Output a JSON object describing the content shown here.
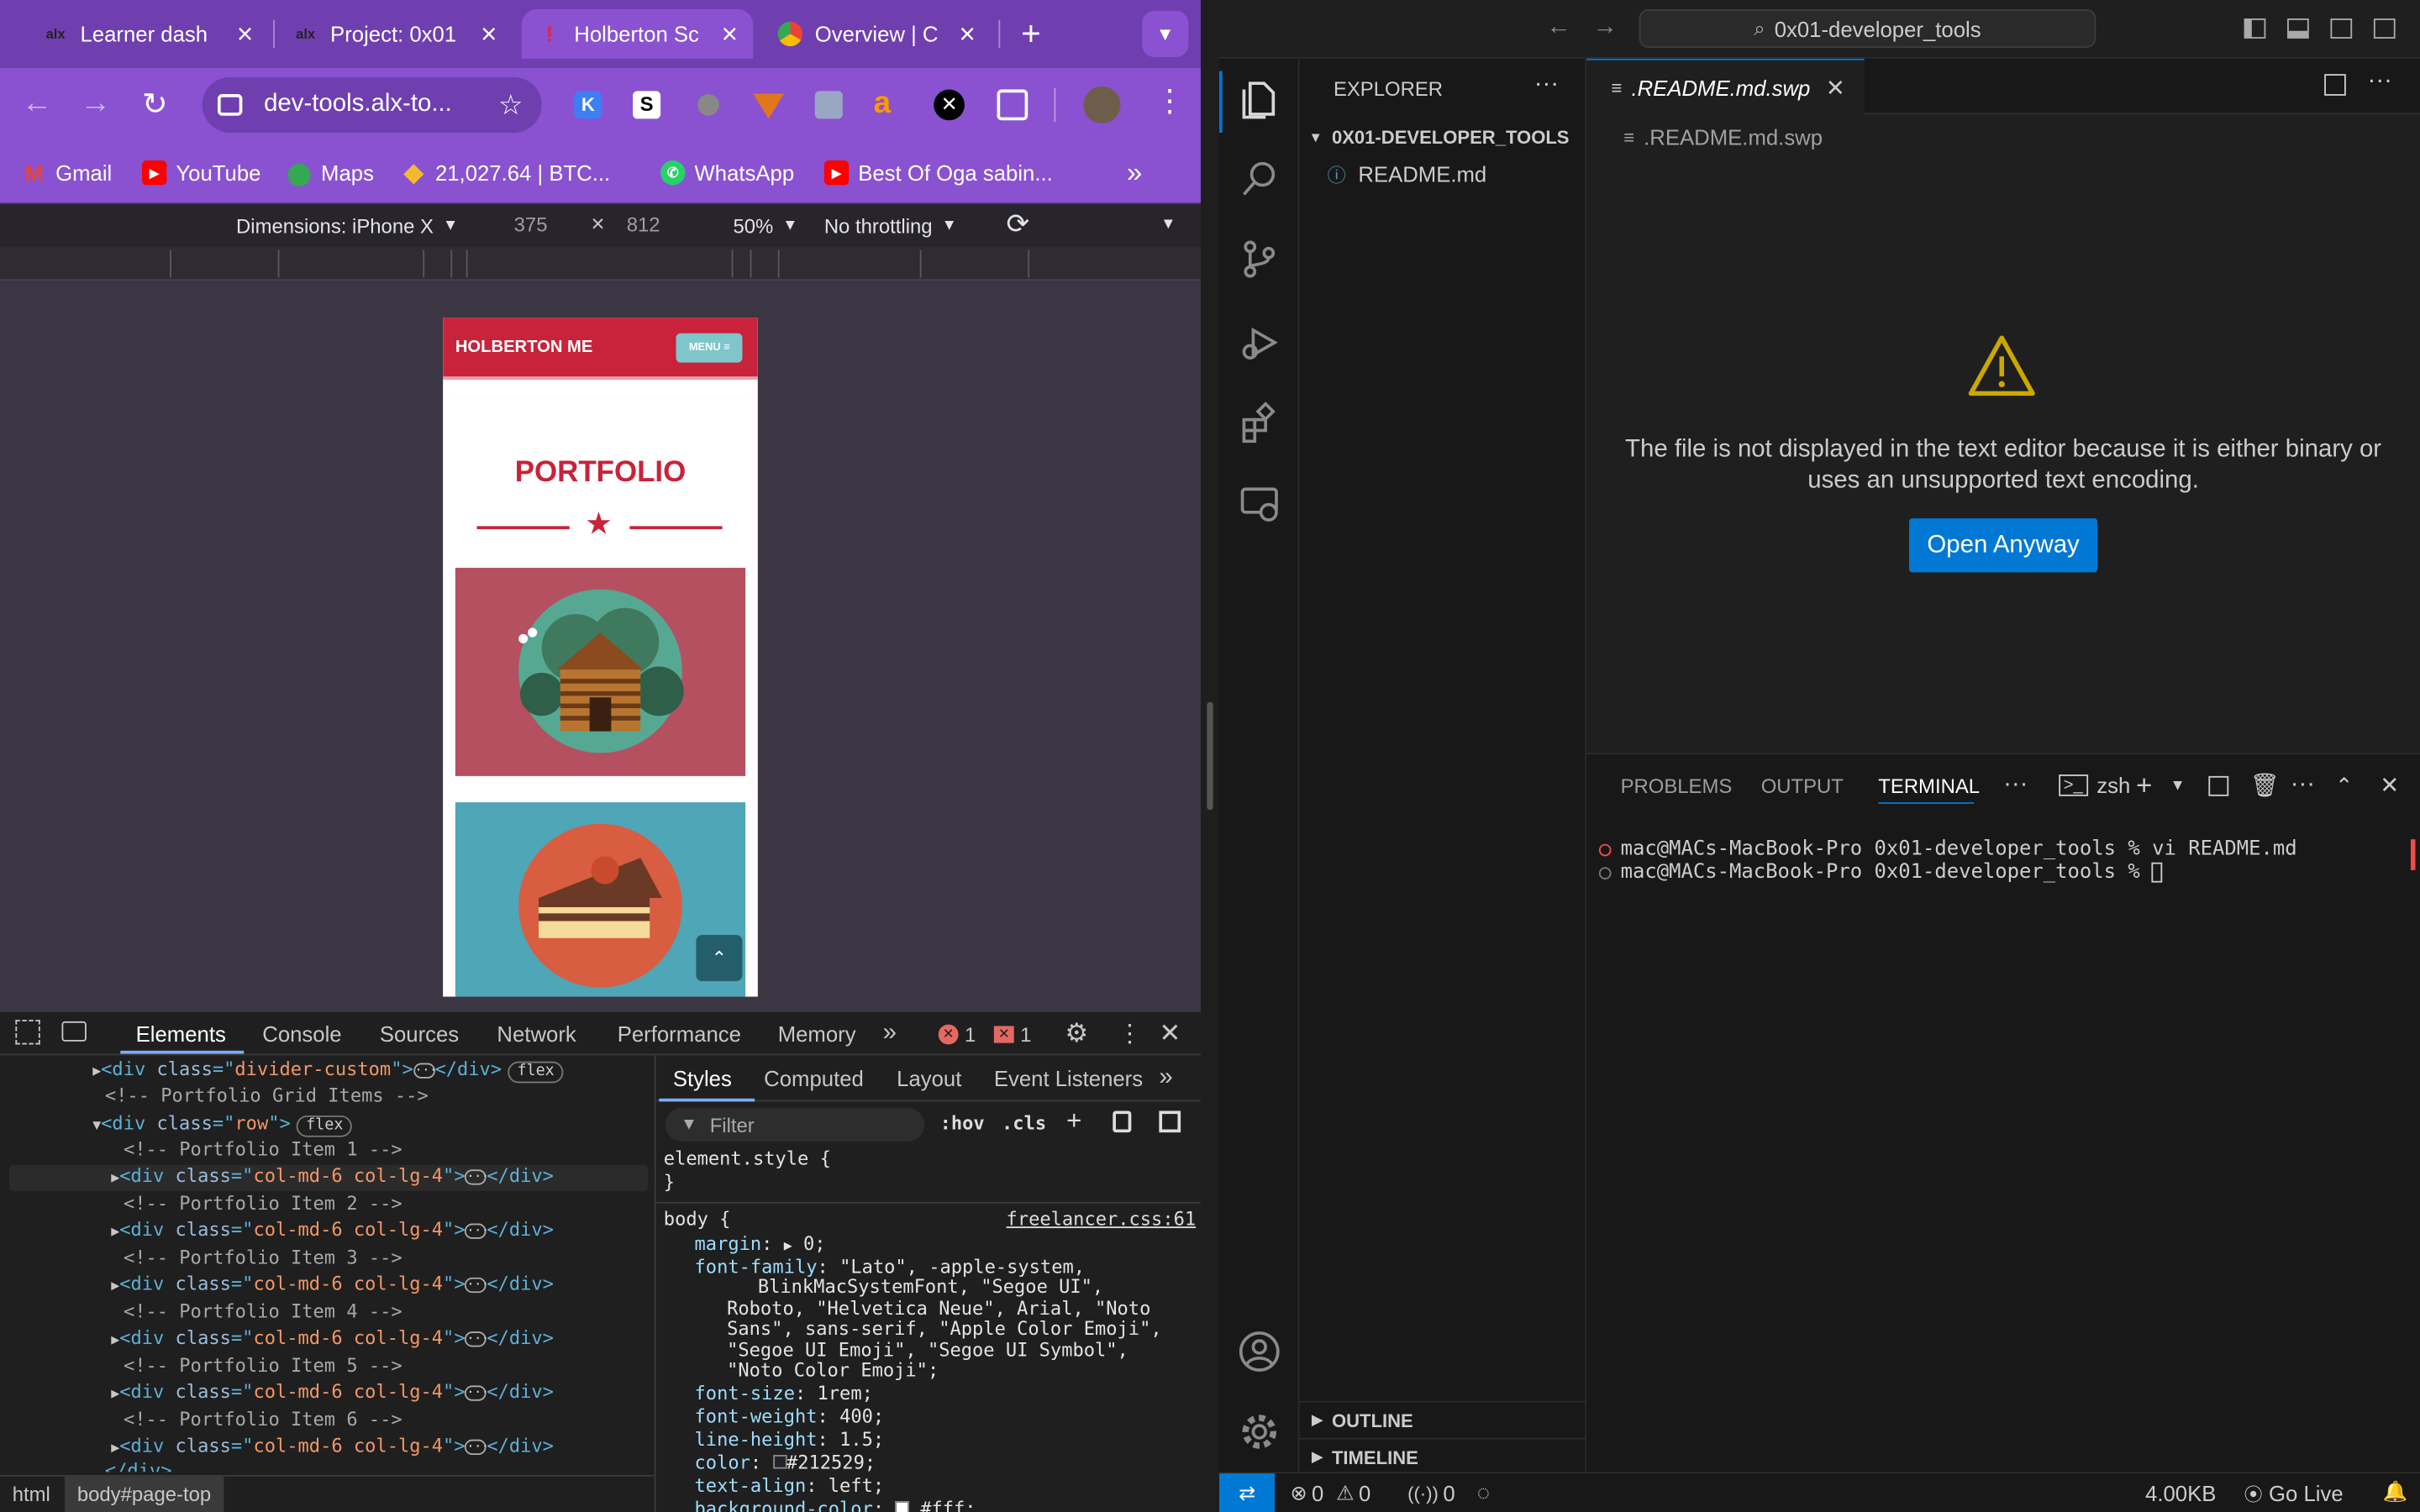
{
  "browser": {
    "tabs": [
      {
        "title": "Learner dash",
        "fav": "alx"
      },
      {
        "title": "Project: 0x01",
        "fav": "alx"
      },
      {
        "title": "Holberton Sc",
        "fav": "!"
      },
      {
        "title": "Overview | C",
        "fav": "G"
      }
    ],
    "address": "dev-tools.alx-to...",
    "bookmarks": [
      "Gmail",
      "YouTube",
      "Maps",
      "21,027.64 | BTC...",
      "WhatsApp",
      "Best Of Oga sabin..."
    ],
    "device": {
      "dimensions_label": "Dimensions: iPhone X",
      "width": "375",
      "times": "×",
      "height": "812",
      "zoom": "50%",
      "throttling": "No throttling"
    },
    "site": {
      "brand": "HOLBERTON ME",
      "menu_label": "MENU ≡",
      "heading": "PORTFOLIO"
    },
    "devtools": {
      "tabs": [
        "Elements",
        "Console",
        "Sources",
        "Network",
        "Performance",
        "Memory"
      ],
      "error_count": "1",
      "issue_count": "1",
      "subtabs": [
        "Styles",
        "Computed",
        "Layout",
        "Event Listeners"
      ],
      "filter_placeholder": "Filter",
      "hov": ":hov",
      "cls": ".cls",
      "breadcrumb": [
        "html",
        "body#page-top"
      ],
      "dom": {
        "divider_class": "divider-custom",
        "flex_pill": "flex",
        "grid_comment": "<!-- Portfolio Grid Items -->",
        "row_class": "row",
        "item_class": "col-md-6 col-lg-4",
        "item_comments": [
          "<!-- Portfolio Item 1 -->",
          "<!-- Portfolio Item 2 -->",
          "<!-- Portfolio Item 3 -->",
          "<!-- Portfolio Item 4 -->",
          "<!-- Portfolio Item 5 -->",
          "<!-- Portfolio Item 6 -->"
        ],
        "closing": "</div>"
      },
      "styles": {
        "element_style": "element.style {",
        "close_brace": "}",
        "body_selector": "body {",
        "source": "freelancer.css:61",
        "margin_prop": "margin",
        "margin_val": "0;",
        "ff_prop": "font-family",
        "ff_lines": [
          "\"Lato\", -apple-system,",
          "BlinkMacSystemFont, \"Segoe UI\",",
          "Roboto, \"Helvetica Neue\", Arial, \"Noto",
          "Sans\", sans-serif, \"Apple Color Emoji\",",
          "\"Segoe UI Emoji\", \"Segoe UI Symbol\",",
          "\"Noto Color Emoji\";"
        ],
        "fs_prop": "font-size",
        "fs_val": "1rem;",
        "fw_prop": "font-weight",
        "fw_val": "400;",
        "lh_prop": "line-height",
        "lh_val": "1.5;",
        "color_prop": "color",
        "color_val": "#212529;",
        "ta_prop": "text-align",
        "ta_val": "left;",
        "bg_prop": "background-color",
        "bg_val": "#fff;"
      }
    }
  },
  "vscode": {
    "search": "0x01-developer_tools",
    "explorer_title": "EXPLORER",
    "folder": "0X01-DEVELOPER_TOOLS",
    "files": [
      "README.md"
    ],
    "tab_title": ".README.md.swp",
    "breadcrumb_file": ".README.md.swp",
    "warning_text": "The file is not displayed in the text editor because it is either binary or uses an unsupported text encoding.",
    "open_anyway": "Open Anyway",
    "panel_tabs": [
      "PROBLEMS",
      "OUTPUT",
      "TERMINAL"
    ],
    "shell": "zsh",
    "terminal_lines": [
      "mac@MACs-MacBook-Pro 0x01-developer_tools % vi README.md",
      "mac@MACs-MacBook-Pro 0x01-developer_tools % "
    ],
    "outline": "OUTLINE",
    "timeline": "TIMELINE",
    "status": {
      "errors": "0",
      "warnings": "0",
      "ports": "0",
      "size": "4.00KB",
      "golive": "Go Live"
    }
  },
  "colors": {
    "tabstrip": "#6f3fb0",
    "toolbar": "#8a52d1",
    "site_red": "#c8233a",
    "vs_blue": "#0078d4",
    "warning": "#cca700"
  }
}
